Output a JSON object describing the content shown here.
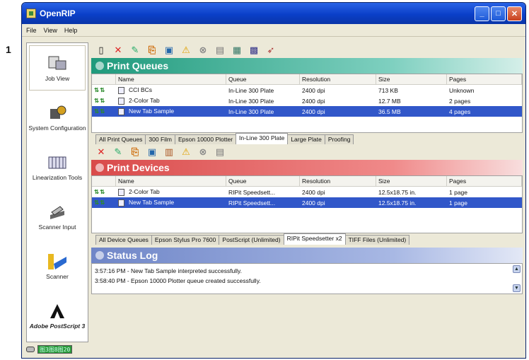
{
  "page_number": "1",
  "window": {
    "title": "OpenRIP"
  },
  "menu": [
    "File",
    "View",
    "Help"
  ],
  "sidebar": [
    {
      "label": "Job View",
      "icon": "job-view-icon"
    },
    {
      "label": "System Configuration",
      "icon": "system-configuration-icon"
    },
    {
      "label": "Linearization Tools",
      "icon": "linearization-tools-icon"
    },
    {
      "label": "Scanner Input",
      "icon": "scanner-input-icon"
    },
    {
      "label": "Scanner",
      "icon": "scanner-icon"
    },
    {
      "label": "Adobe PostScript 3",
      "icon": "adobe-postscript-logo"
    }
  ],
  "queues": {
    "title": "Print Queues",
    "columns": [
      "Name",
      "Queue",
      "Resolution",
      "Size",
      "Pages"
    ],
    "rows": [
      {
        "name": "CCI BCs",
        "queue": "In-Line 300 Plate",
        "resolution": "2400 dpi",
        "size": "713 KB",
        "pages": "Unknown",
        "selected": false
      },
      {
        "name": "2-Color Tab",
        "queue": "In-Line 300 Plate",
        "resolution": "2400 dpi",
        "size": "12.7 MB",
        "pages": "2 pages",
        "selected": false
      },
      {
        "name": "New Tab Sample",
        "queue": "In-Line 300 Plate",
        "resolution": "2400 dpi",
        "size": "36.5 MB",
        "pages": "4 pages",
        "selected": true
      }
    ],
    "tabs": [
      "All Print Queues",
      "300 Film",
      "Epson 10000 Plotter",
      "In-Line 300 Plate",
      "Large Plate",
      "Proofing"
    ],
    "active_tab": 3
  },
  "devices": {
    "title": "Print Devices",
    "columns": [
      "Name",
      "Queue",
      "Resolution",
      "Size",
      "Pages"
    ],
    "rows": [
      {
        "name": "2-Color Tab",
        "queue": "RIPit Speedsett...",
        "resolution": "2400 dpi",
        "size": "12.5x18.75 in.",
        "pages": "1 page",
        "selected": false
      },
      {
        "name": "New Tab Sample",
        "queue": "RIPit Speedsett...",
        "resolution": "2400 dpi",
        "size": "12.5x18.75 in.",
        "pages": "1 page",
        "selected": true
      }
    ],
    "tabs": [
      "All Device Queues",
      "Epson Stylus Pro 7600",
      "PostScript (Unlimited)",
      "RIPit Speedsetter x2",
      "TIFF Files (Unlimited)"
    ],
    "active_tab": 3
  },
  "status": {
    "title": "Status Log",
    "lines": [
      "3:57:16 PM - New Tab Sample interpreted successfully.",
      "3:58:40 PM - Epson 10000 Plotter queue created successfully."
    ]
  },
  "statusbar": {
    "indicator": "图3图8图20"
  },
  "colors": {
    "queues_band": "#1f9a7c",
    "devices_band": "#d94a4a",
    "status_band": "#6f86c8",
    "selection": "#3157c9"
  }
}
